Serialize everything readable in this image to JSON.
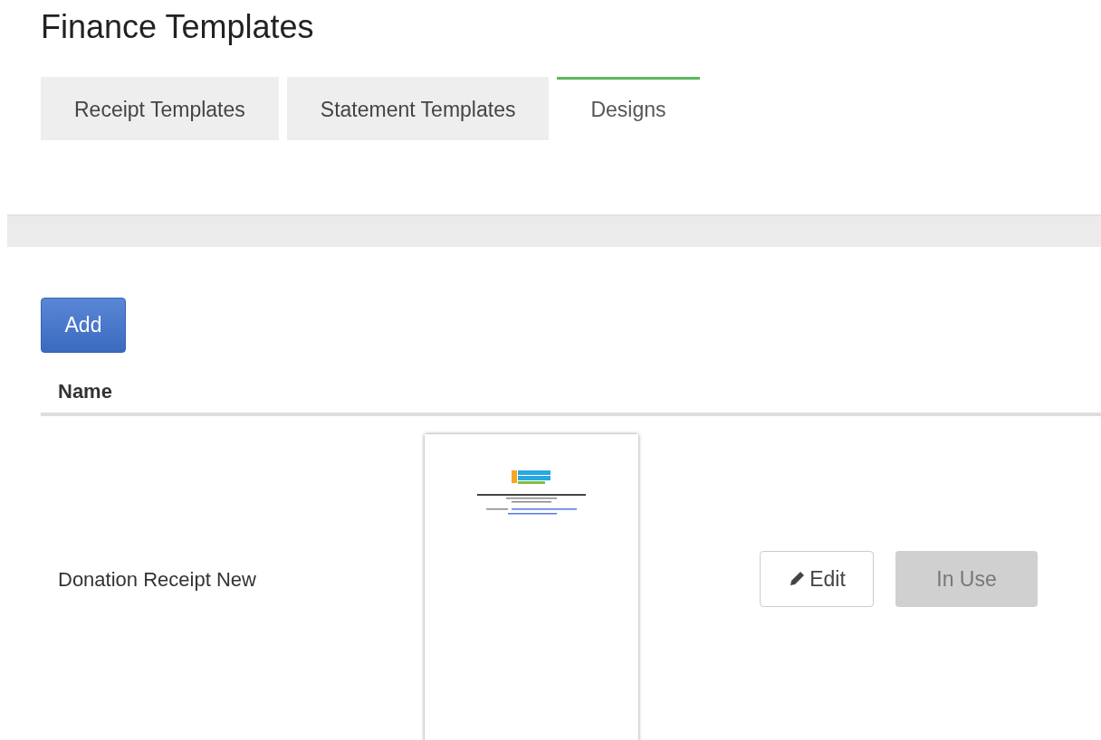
{
  "page": {
    "title": "Finance Templates"
  },
  "tabs": [
    {
      "label": "Receipt Templates",
      "selected": false
    },
    {
      "label": "Statement Templates",
      "selected": false
    },
    {
      "label": "Designs",
      "selected": true
    }
  ],
  "add_button": {
    "label": "Add"
  },
  "table": {
    "columns": [
      "Name"
    ],
    "rows": [
      {
        "name": "Donation Receipt New",
        "edit_label": "Edit",
        "status_label": "In Use",
        "in_use": true
      }
    ]
  }
}
